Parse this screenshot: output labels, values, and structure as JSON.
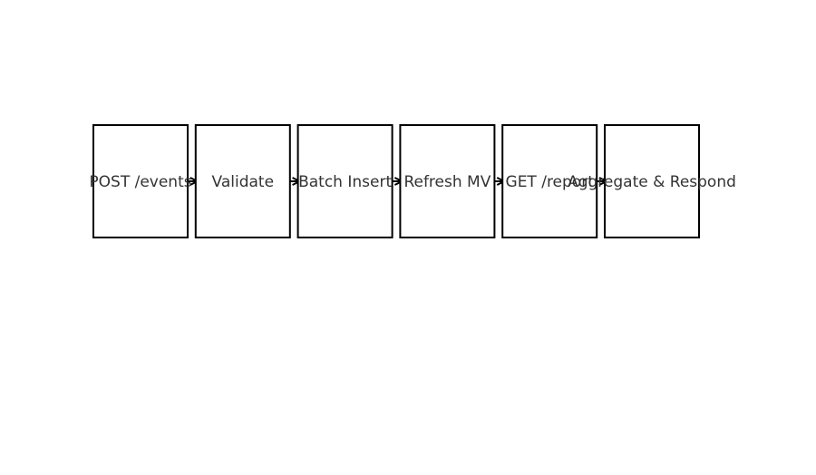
{
  "diagram": {
    "type": "flowchart",
    "direction": "left-to-right",
    "nodes": [
      {
        "id": "post_events",
        "label": "POST /events"
      },
      {
        "id": "validate",
        "label": "Validate"
      },
      {
        "id": "batch_insert",
        "label": "Batch Insert"
      },
      {
        "id": "refresh_mv",
        "label": "Refresh MV"
      },
      {
        "id": "get_report",
        "label": "GET /report"
      },
      {
        "id": "aggregate_respond",
        "label": "Aggregate & Respond"
      }
    ],
    "edges": [
      {
        "from": "post_events",
        "to": "validate"
      },
      {
        "from": "validate",
        "to": "batch_insert"
      },
      {
        "from": "batch_insert",
        "to": "refresh_mv"
      },
      {
        "from": "refresh_mv",
        "to": "get_report"
      },
      {
        "from": "get_report",
        "to": "aggregate_respond"
      }
    ],
    "colors": {
      "box_stroke": "#000000",
      "box_fill": "#ffffff",
      "text": "#333333",
      "arrow": "#000000"
    }
  }
}
